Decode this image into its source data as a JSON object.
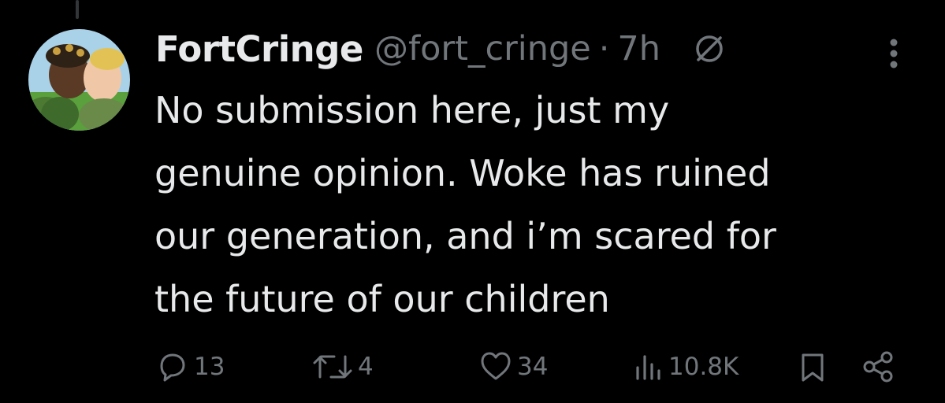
{
  "tweet": {
    "display_name": "FortCringe",
    "handle": "@fort_cringe",
    "separator": "·",
    "time": "7h",
    "badge_icon": "circle-slash-icon",
    "more_icon": "vertical-ellipsis-icon",
    "text_lines": [
      "No submission here, just my",
      "genuine opinion. Woke has ruined",
      "our generation, and i’m scared for",
      "the future of our children"
    ]
  },
  "actions": {
    "reply": {
      "icon": "reply-icon",
      "count": "13"
    },
    "retweet": {
      "icon": "retweet-icon",
      "count": "4"
    },
    "like": {
      "icon": "heart-icon",
      "count": "34"
    },
    "views": {
      "icon": "views-chart-icon",
      "count": "10.8K"
    },
    "bookmark": {
      "icon": "bookmark-icon"
    },
    "share": {
      "icon": "share-icon"
    }
  },
  "colors": {
    "background": "#000000",
    "primary_text": "#e7e9ea",
    "secondary_text": "#71767b",
    "thread_line": "#333639"
  }
}
